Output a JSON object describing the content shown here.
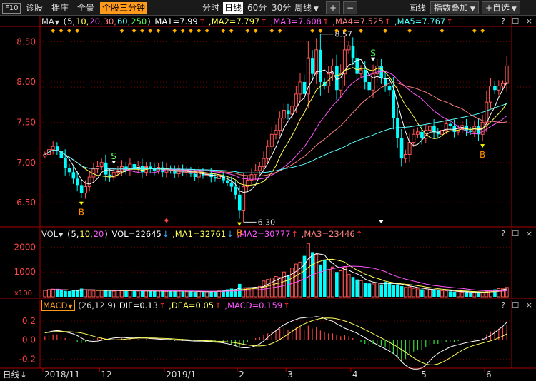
{
  "toolbar": {
    "badge": "F10",
    "items": [
      "诊股",
      "摇庄",
      "全景"
    ],
    "active_tab": "个股三分钟",
    "periods": [
      {
        "label": "分时",
        "selected": false
      },
      {
        "label": "日线",
        "selected": true
      },
      {
        "label": "60分",
        "selected": false
      },
      {
        "label": "30分",
        "selected": false
      },
      {
        "label": "周线",
        "selected": false,
        "dropdown": true
      }
    ],
    "plus": "+",
    "minus": "−",
    "right_items": [
      "画线",
      "指数叠加",
      "+自选"
    ]
  },
  "price_panel": {
    "indicator": "MA",
    "params": "(5,10,20,30,60,250)",
    "values": [
      {
        "label": "MA1=7.99",
        "arrow": "↑",
        "color": "#ffffff"
      },
      {
        "label": "MA2=7.797",
        "arrow": "↑",
        "color": "#ffff55"
      },
      {
        "label": "MA3=7.608",
        "arrow": "↑",
        "color": "#ff55ff"
      },
      {
        "label": "MA4=7.525",
        "arrow": "↑",
        "color": "#ff8080"
      },
      {
        "label": "MA5=7.767",
        "arrow": "↑",
        "color": "#55ffff"
      }
    ],
    "param_colors": [
      "#ffffff",
      "#ffff55",
      "#ff55ff",
      "#ff8080",
      "#55ffff",
      "#55ff55"
    ],
    "max_label": "8.57",
    "min_label": "6.30",
    "signal_b": "B",
    "signal_s": "S",
    "corner": "? ☐ ×"
  },
  "vol_panel": {
    "indicator": "VOL",
    "params": "(5,10,20)",
    "values": [
      {
        "label": "VOL=22645",
        "arrow": "↓",
        "color": "#ffffff"
      },
      {
        "label": "MA1=32761",
        "arrow": "↓",
        "color": "#ffff55"
      },
      {
        "label": "MA2=30777",
        "arrow": "↑",
        "color": "#ff55ff"
      },
      {
        "label": "MA3=23446",
        "arrow": "↑",
        "color": "#ff8080"
      }
    ],
    "unit": "x100",
    "corner": "? ☐ ×"
  },
  "macd_panel": {
    "indicator": "MACD",
    "params": "(26,12,9)",
    "values": [
      {
        "label": "DIF=0.13",
        "arrow": "↑",
        "color": "#ffffff"
      },
      {
        "label": "DEA=0.05",
        "arrow": "↑",
        "color": "#ffff55"
      },
      {
        "label": "MACD=0.159",
        "arrow": "↑",
        "color": "#ff55ff"
      }
    ],
    "corner": "? ☐ ×"
  },
  "bottom": {
    "period": "日线",
    "dates": [
      "2018/11",
      "12",
      "2019/1",
      "2",
      "3",
      "4",
      "5",
      "6"
    ]
  },
  "colors": {
    "up": "#ff5555",
    "down": "#00ffff",
    "grid": "#6b0000",
    "axis": "#aa0000",
    "price_label": "#ff4444",
    "signal_b": "#ff8c00",
    "signal_s": "#55ff55",
    "diamond": "#ffb000"
  },
  "chart_data": [
    {
      "type": "candlestick",
      "ylim": [
        6.2,
        8.7
      ],
      "yticks": [
        6.5,
        7.0,
        7.5,
        8.0,
        8.5
      ],
      "x_dates": [
        "2018/11",
        "12",
        "2019/1",
        "2",
        "3",
        "4",
        "5",
        "6"
      ],
      "close": [
        7.1,
        7.16,
        7.2,
        7.14,
        7.06,
        6.93,
        6.88,
        6.8,
        6.72,
        6.62,
        6.7,
        6.82,
        6.92,
        6.95,
        7.0,
        6.85,
        6.82,
        6.88,
        6.9,
        6.95,
        6.9,
        6.98,
        6.92,
        6.96,
        6.88,
        6.95,
        6.92,
        6.9,
        6.94,
        6.88,
        6.92,
        6.9,
        6.86,
        6.92,
        6.88,
        6.9,
        6.86,
        6.82,
        6.88,
        6.84,
        6.86,
        6.82,
        6.8,
        6.84,
        6.78,
        6.75,
        6.7,
        6.6,
        6.4,
        6.7,
        6.78,
        6.85,
        6.9,
        6.95,
        7.05,
        7.2,
        7.35,
        7.4,
        7.55,
        7.65,
        7.6,
        7.7,
        7.85,
        8.0,
        7.85,
        8.3,
        8.1,
        8.4,
        8.0,
        7.95,
        8.1,
        8.2,
        7.9,
        8.1,
        8.4,
        8.45,
        8.3,
        8.1,
        8.15,
        8.0,
        7.9,
        8.1,
        8.2,
        8.05,
        7.95,
        7.9,
        7.55,
        7.3,
        7.05,
        7.1,
        7.25,
        7.35,
        7.38,
        7.3,
        7.4,
        7.45,
        7.38,
        7.35,
        7.4,
        7.48,
        7.45,
        7.38,
        7.42,
        7.46,
        7.4,
        7.38,
        7.45,
        7.35,
        7.5,
        7.75,
        7.95,
        7.9,
        7.95,
        7.98,
        8.2
      ],
      "ma_lines": [
        "MA1",
        "MA2",
        "MA3",
        "MA4",
        "MA5"
      ]
    },
    {
      "type": "bar",
      "ylim": [
        0,
        2300
      ],
      "yticks": [
        1000,
        2000
      ],
      "values": [
        260,
        290,
        310,
        320,
        270,
        240,
        230,
        260,
        280,
        330,
        290,
        260,
        240,
        250,
        270,
        260,
        240,
        230,
        250,
        240,
        260,
        250,
        240,
        230,
        230,
        250,
        240,
        220,
        240,
        230,
        220,
        250,
        230,
        240,
        220,
        210,
        230,
        200,
        220,
        210,
        200,
        220,
        230,
        240,
        260,
        300,
        330,
        310,
        520,
        350,
        330,
        360,
        380,
        420,
        640,
        700,
        760,
        820,
        780,
        1000,
        860,
        1160,
        1320,
        1400,
        1650,
        2150,
        1800,
        1700,
        1300,
        1500,
        1100,
        1200,
        1000,
        1050,
        1200,
        900,
        800,
        700,
        650,
        560,
        540,
        520,
        560,
        500,
        600,
        540,
        480,
        500,
        430,
        380,
        400,
        340,
        320,
        300,
        280,
        300,
        270,
        260,
        250,
        240,
        220,
        200,
        210,
        190,
        200,
        180,
        170,
        190,
        180,
        220,
        260,
        300,
        330,
        320,
        380
      ]
    },
    {
      "type": "bar",
      "ylim": [
        -0.28,
        0.32
      ],
      "yticks": [
        -0.2,
        0.0,
        0.2
      ],
      "hist": [
        0.04,
        0.05,
        0.06,
        0.06,
        0.04,
        0.02,
        0.01,
        0.0,
        -0.02,
        -0.03,
        -0.02,
        0.0,
        0.01,
        0.02,
        0.03,
        0.01,
        0.0,
        0.01,
        0.01,
        0.02,
        0.01,
        0.02,
        0.01,
        0.01,
        0.0,
        0.01,
        0.0,
        0.0,
        0.01,
        0.0,
        0.0,
        0.0,
        -0.01,
        0.0,
        -0.01,
        0.0,
        -0.01,
        -0.01,
        0.0,
        -0.01,
        -0.01,
        -0.02,
        -0.02,
        -0.02,
        -0.03,
        -0.03,
        -0.04,
        -0.06,
        -0.08,
        -0.04,
        -0.02,
        0.0,
        0.02,
        0.03,
        0.05,
        0.07,
        0.09,
        0.1,
        0.12,
        0.13,
        0.11,
        0.12,
        0.13,
        0.14,
        0.11,
        0.15,
        0.12,
        0.14,
        0.1,
        0.08,
        0.07,
        0.07,
        0.05,
        0.04,
        0.05,
        0.04,
        0.02,
        0.0,
        -0.02,
        -0.04,
        -0.05,
        -0.04,
        -0.05,
        -0.06,
        -0.08,
        -0.1,
        -0.14,
        -0.18,
        -0.22,
        -0.2,
        -0.16,
        -0.12,
        -0.1,
        -0.1,
        -0.07,
        -0.05,
        -0.04,
        -0.04,
        -0.03,
        -0.02,
        -0.02,
        -0.02,
        -0.01,
        0.0,
        0.0,
        0.0,
        0.01,
        0.0,
        0.02,
        0.06,
        0.09,
        0.11,
        0.12,
        0.13,
        0.16
      ]
    }
  ]
}
